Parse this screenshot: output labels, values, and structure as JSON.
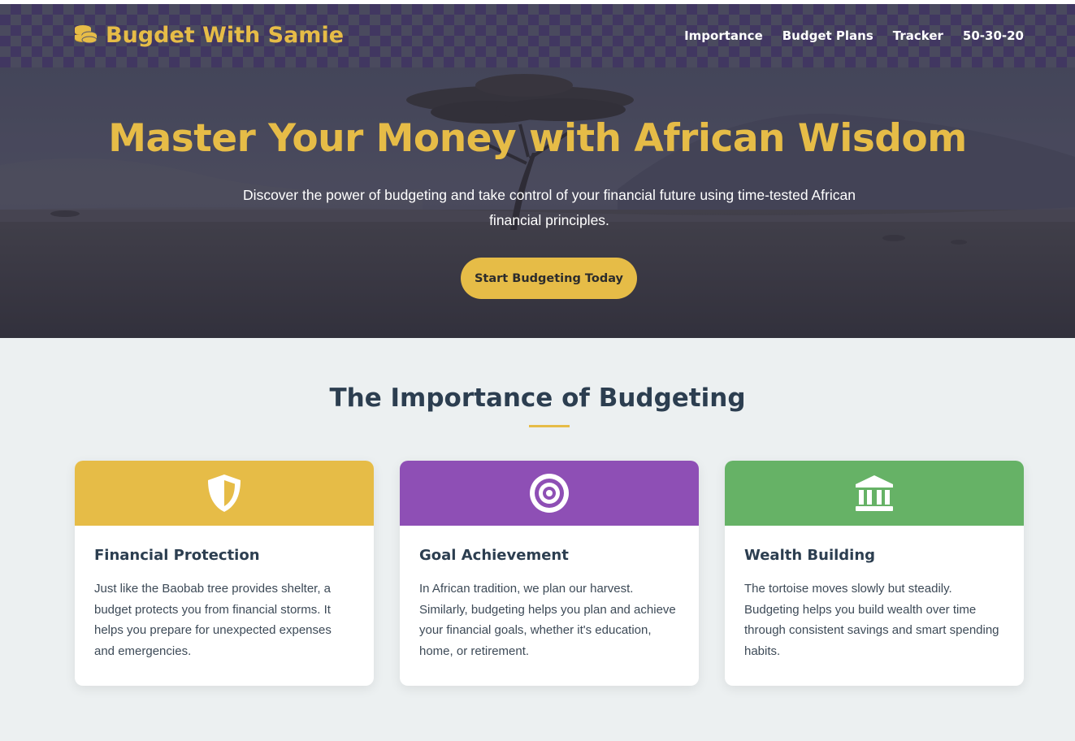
{
  "brand": {
    "name": "Bugdet With Samie",
    "icon": "coins-icon",
    "color": "#e6bc47"
  },
  "nav": {
    "items": [
      "Importance",
      "Budget Plans",
      "Tracker",
      "50-30-20"
    ]
  },
  "hero": {
    "title": "Master Your Money with African Wisdom",
    "subtitle": "Discover the power of budgeting and take control of your financial future using time-tested African financial principles.",
    "cta": "Start Budgeting Today"
  },
  "importance": {
    "title": "The Importance of Budgeting",
    "cards": [
      {
        "title": "Financial Protection",
        "text": "Just like the Baobab tree provides shelter, a budget protects you from financial storms. It helps you prepare for unexpected expenses and emergencies.",
        "icon": "shield-icon",
        "color": "#e6bc47"
      },
      {
        "title": "Goal Achievement",
        "text": "In African tradition, we plan our harvest. Similarly, budgeting helps you plan and achieve your financial goals, whether it's education, home, or retirement.",
        "icon": "target-icon",
        "color": "#8e4fb5"
      },
      {
        "title": "Wealth Building",
        "text": "The tortoise moves slowly but steadily. Budgeting helps you build wealth over time through consistent savings and smart spending habits.",
        "icon": "bank-icon",
        "color": "#66b266"
      }
    ]
  }
}
